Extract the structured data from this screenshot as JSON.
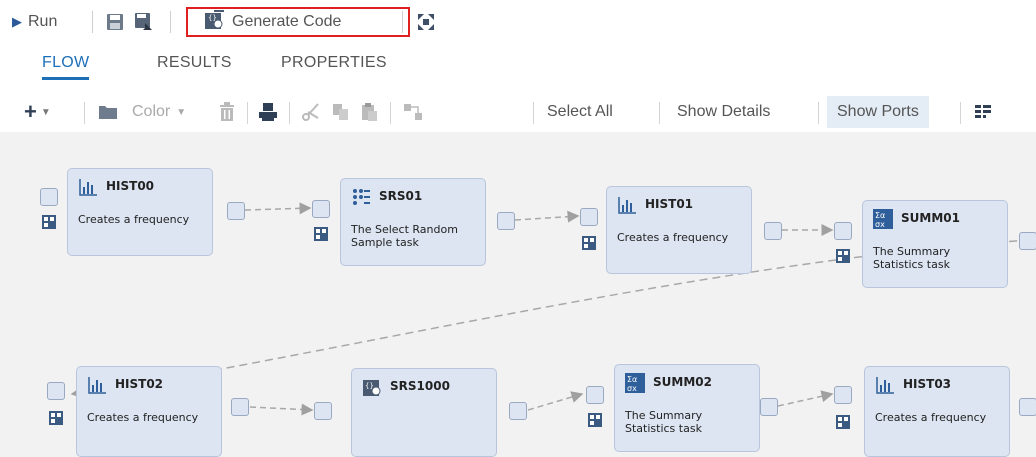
{
  "toolbar": {
    "run_label": "Run",
    "generate_label": "Generate Code"
  },
  "tabs": [
    {
      "label": "FLOW",
      "active": true
    },
    {
      "label": "RESULTS",
      "active": false
    },
    {
      "label": "PROPERTIES",
      "active": false
    }
  ],
  "flow_toolbar": {
    "color_label": "Color",
    "select_all_label": "Select All",
    "show_details_label": "Show Details",
    "show_ports_label": "Show Ports"
  },
  "nodes": [
    {
      "id": "HIST00",
      "title": "HIST00",
      "desc": "Creates a frequency",
      "icon": "histogram-icon"
    },
    {
      "id": "SRS01",
      "title": "SRS01",
      "desc": "The Select Random Sample task",
      "icon": "random-sample-icon"
    },
    {
      "id": "HIST01",
      "title": "HIST01",
      "desc": "Creates a frequency",
      "icon": "histogram-icon"
    },
    {
      "id": "SUMM01",
      "title": "SUMM01",
      "desc": "The Summary Statistics task",
      "icon": "summary-stats-icon"
    },
    {
      "id": "HIST02",
      "title": "HIST02",
      "desc": "Creates a frequency",
      "icon": "histogram-icon"
    },
    {
      "id": "SRS1000",
      "title": "SRS1000",
      "desc": "",
      "icon": "code-node-icon"
    },
    {
      "id": "SUMM02",
      "title": "SUMM02",
      "desc": "The Summary Statistics task",
      "icon": "summary-stats-icon"
    },
    {
      "id": "HIST03",
      "title": "HIST03",
      "desc": "Creates a frequency",
      "icon": "histogram-icon"
    }
  ],
  "colors": {
    "accent": "#1d6fb8",
    "highlight_border": "#e02020",
    "node_fill": "#dde5f2",
    "canvas_bg": "#f2f2f2"
  }
}
